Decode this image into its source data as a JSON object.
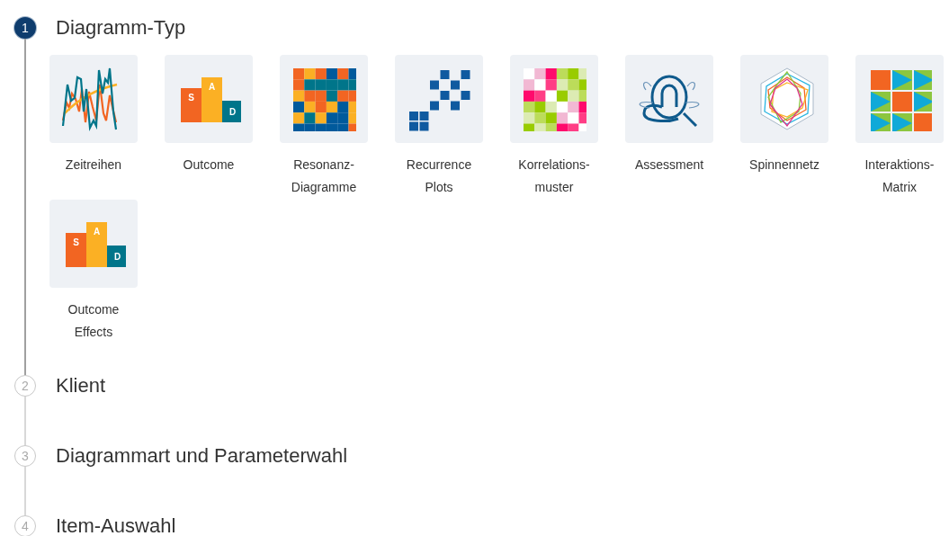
{
  "steps": [
    {
      "number": "1",
      "title": "Diagramm-Typ",
      "active": true,
      "chart_types": [
        {
          "kind": "timeseries",
          "label": [
            "Zeitreihen"
          ]
        },
        {
          "kind": "outcome",
          "label": [
            "Outcome"
          ],
          "bar_labels": [
            "S",
            "A",
            "D"
          ]
        },
        {
          "kind": "resonance",
          "label": [
            "Resonanz-",
            "Diagramme"
          ]
        },
        {
          "kind": "recurrence",
          "label": [
            "Recurrence",
            "Plots"
          ]
        },
        {
          "kind": "correlation",
          "label": [
            "Korrelations-",
            "muster"
          ]
        },
        {
          "kind": "assessment",
          "label": [
            "Assessment"
          ]
        },
        {
          "kind": "spider",
          "label": [
            "Spinnennetz"
          ]
        },
        {
          "kind": "interaction",
          "label": [
            "Interaktions-",
            "Matrix"
          ]
        },
        {
          "kind": "outcome",
          "label": [
            "Outcome",
            "Effects"
          ],
          "bar_labels": [
            "S",
            "A",
            "D"
          ]
        }
      ]
    },
    {
      "number": "2",
      "title": "Klient",
      "active": false
    },
    {
      "number": "3",
      "title": "Diagrammart und Parameterwahl",
      "active": false
    },
    {
      "number": "4",
      "title": "Item-Auswahl",
      "active": false
    }
  ]
}
